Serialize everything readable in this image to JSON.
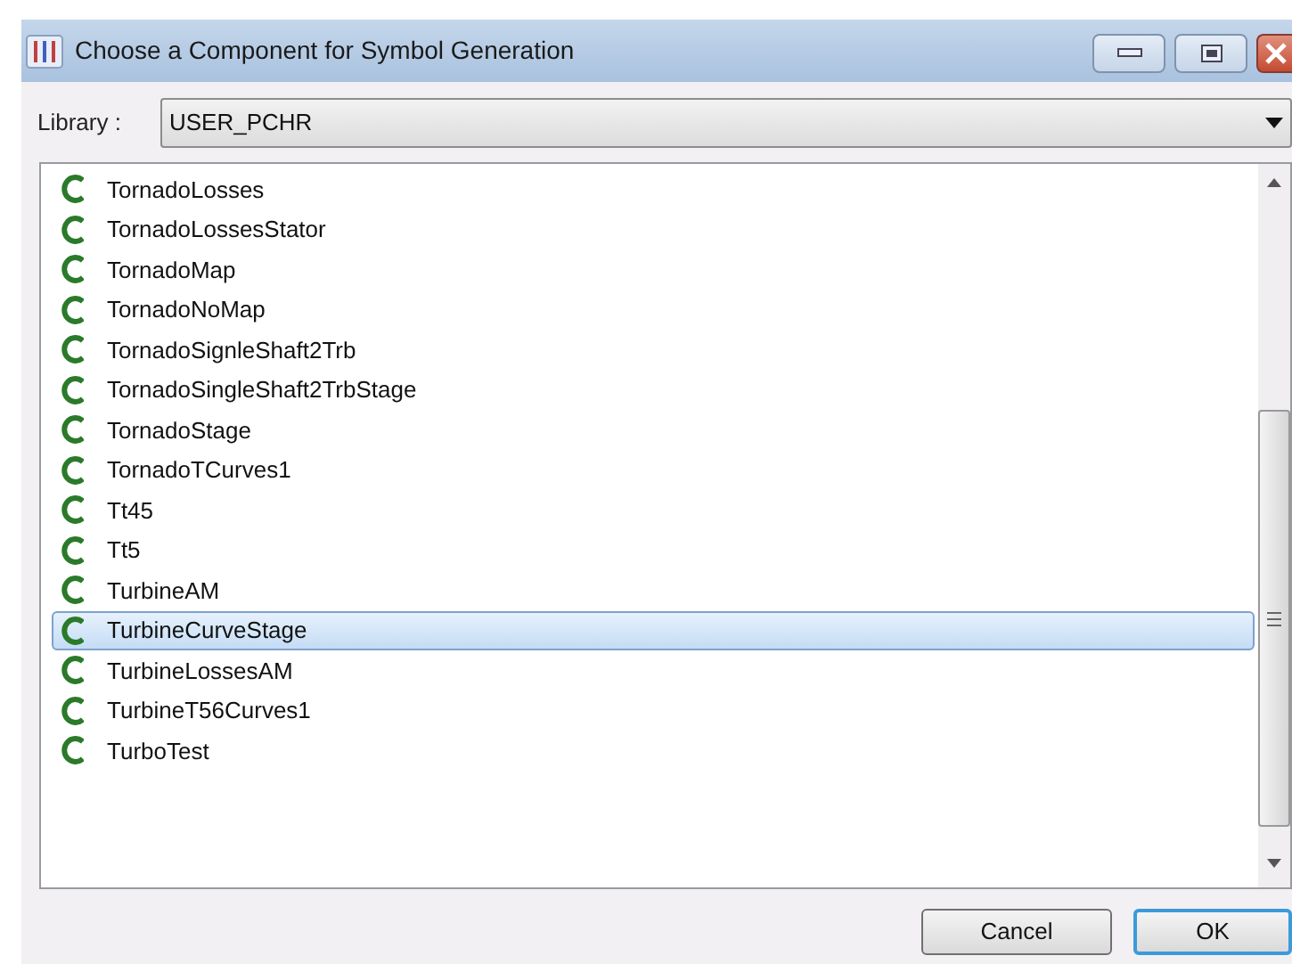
{
  "window": {
    "title": "Choose a Component for Symbol Generation"
  },
  "library": {
    "label": "Library :",
    "value": "USER_PCHR"
  },
  "components": [
    {
      "name": "TornadoLosses",
      "selected": false
    },
    {
      "name": "TornadoLossesStator",
      "selected": false
    },
    {
      "name": "TornadoMap",
      "selected": false
    },
    {
      "name": "TornadoNoMap",
      "selected": false
    },
    {
      "name": "TornadoSignleShaft2Trb",
      "selected": false
    },
    {
      "name": "TornadoSingleShaft2TrbStage",
      "selected": false
    },
    {
      "name": "TornadoStage",
      "selected": false
    },
    {
      "name": "TornadoTCurves1",
      "selected": false
    },
    {
      "name": "Tt45",
      "selected": false
    },
    {
      "name": "Tt5",
      "selected": false
    },
    {
      "name": "TurbineAM",
      "selected": false
    },
    {
      "name": "TurbineCurveStage",
      "selected": true
    },
    {
      "name": "TurbineLossesAM",
      "selected": false
    },
    {
      "name": "TurbineT56Curves1",
      "selected": false
    },
    {
      "name": "TurboTest",
      "selected": false
    }
  ],
  "buttons": [
    {
      "label": "Cancel",
      "default": false
    },
    {
      "label": "OK",
      "default": true
    }
  ]
}
